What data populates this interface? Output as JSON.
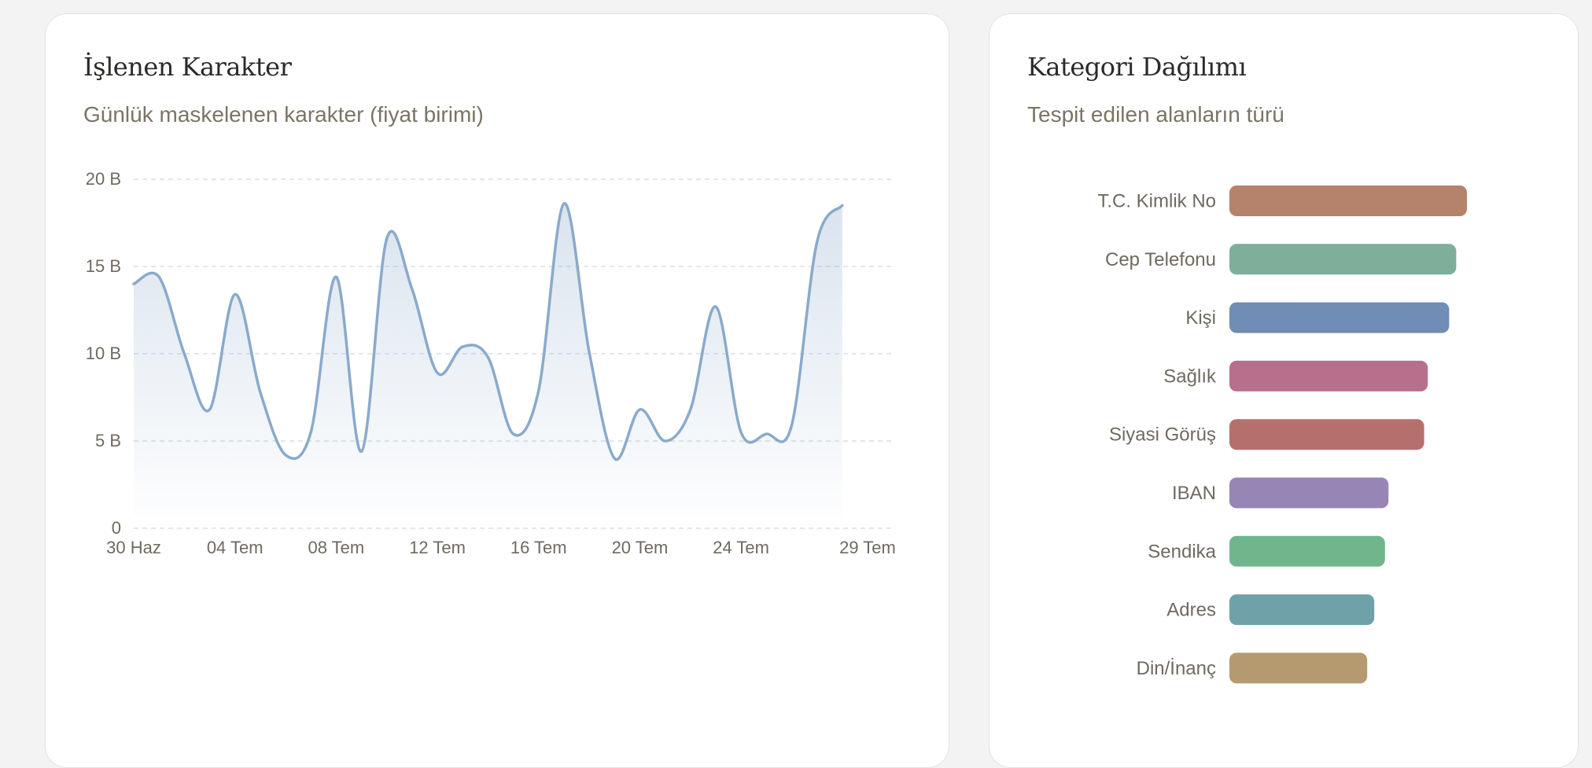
{
  "colors": {
    "background": "#f3f3f3",
    "card": "#ffffff",
    "line": "#8aaacb",
    "grid": "#d9dde3"
  },
  "left_card": {
    "title": "İşlenen Karakter",
    "subtitle": "Günlük maskelenen karakter (fiyat birimi)"
  },
  "right_card": {
    "title": "Kategori Dağılımı",
    "subtitle": "Tespit edilen alanların türü"
  },
  "chart_data": [
    {
      "type": "area",
      "title": "İşlenen Karakter",
      "subtitle": "Günlük maskelenen karakter (fiyat birimi)",
      "xlabel": "",
      "ylabel": "",
      "ylim": [
        0,
        20
      ],
      "yticks": [
        0,
        5,
        10,
        15,
        20
      ],
      "ytick_labels": [
        "0",
        "5 B",
        "10 B",
        "15 B",
        "20 B"
      ],
      "xtick_labels": [
        "30 Haz",
        "04 Tem",
        "08 Tem",
        "12 Tem",
        "16 Tem",
        "20 Tem",
        "24 Tem",
        "29 Tem"
      ],
      "xtick_days": [
        0,
        4,
        8,
        12,
        16,
        20,
        24,
        29
      ],
      "grid": true,
      "x": [
        "30 Haz",
        "01 Tem",
        "02 Tem",
        "03 Tem",
        "04 Tem",
        "05 Tem",
        "06 Tem",
        "07 Tem",
        "08 Tem",
        "09 Tem",
        "10 Tem",
        "11 Tem",
        "12 Tem",
        "13 Tem",
        "14 Tem",
        "15 Tem",
        "16 Tem",
        "17 Tem",
        "18 Tem",
        "19 Tem",
        "20 Tem",
        "21 Tem",
        "22 Tem",
        "23 Tem",
        "24 Tem",
        "25 Tem",
        "26 Tem",
        "27 Tem",
        "28 Tem"
      ],
      "series": [
        {
          "color": "#8aaacb",
          "values": [
            14.0,
            14.4,
            10.0,
            6.8,
            13.4,
            7.8,
            4.2,
            5.5,
            14.4,
            4.4,
            16.6,
            13.7,
            8.9,
            10.4,
            9.8,
            5.4,
            7.9,
            18.6,
            10.1,
            4.0,
            6.8,
            5.0,
            6.8,
            12.7,
            5.5,
            5.4,
            5.9,
            16.4,
            18.5
          ]
        }
      ]
    },
    {
      "type": "bar",
      "orientation": "horizontal",
      "title": "Kategori Dağılımı",
      "subtitle": "Tespit edilen alanların türü",
      "categories": [
        "T.C. Kimlik No",
        "Cep Telefonu",
        "Kişi",
        "Sağlık",
        "Siyasi Görüş",
        "IBAN",
        "Sendika",
        "Adres",
        "Din/İnanç"
      ],
      "values": [
        100,
        95.5,
        92.5,
        83.5,
        82,
        67,
        65.5,
        61,
        58
      ],
      "colors": [
        "#b5826b",
        "#7eaf9a",
        "#6f8db5",
        "#b76f8b",
        "#b5706e",
        "#9786b5",
        "#6fb68c",
        "#6fa2a8",
        "#b59a6f"
      ],
      "grid": false
    }
  ]
}
